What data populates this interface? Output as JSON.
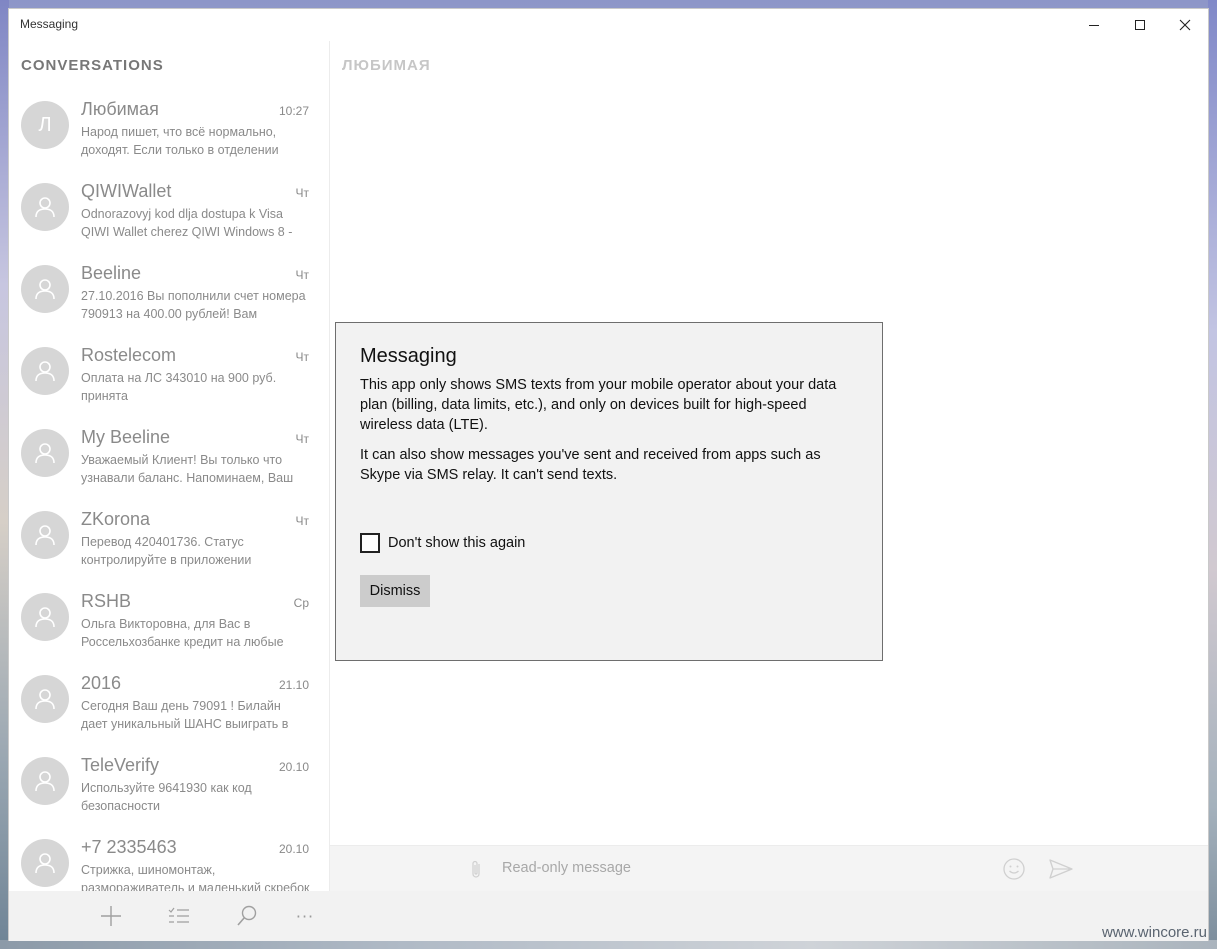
{
  "window": {
    "title": "Messaging"
  },
  "sidebar": {
    "header": "CONVERSATIONS",
    "conversations": [
      {
        "avatar_letter": "Л",
        "name": "Любимая",
        "time": "10:27",
        "preview": "Народ пишет, что всё нормально,\nдоходят. Если только в отделении"
      },
      {
        "avatar_letter": "",
        "name": "QIWIWallet",
        "time": "Чт",
        "preview": "Odnorazovyj kod dlja dostupa k Visa\nQIWI Wallet cherez QIWI Windows 8 -"
      },
      {
        "avatar_letter": "",
        "name": "Beeline",
        "time": "Чт",
        "preview": "27.10.2016 Вы пополнили счет номера\n790913           на 400.00 рублей! Вам"
      },
      {
        "avatar_letter": "",
        "name": "Rostelecom",
        "time": "Чт",
        "preview": "Оплата на ЛС 343010            на 900 руб.\nпринята"
      },
      {
        "avatar_letter": "",
        "name": "My Beeline",
        "time": "Чт",
        "preview": "Уважаемый Клиент! Вы только что\nузнавали баланс. Напоминаем, Ваш"
      },
      {
        "avatar_letter": "",
        "name": "ZKorona",
        "time": "Чт",
        "preview": "Перевод 420401736. Статус\nконтролируйте в приложении"
      },
      {
        "avatar_letter": "",
        "name": "RSHB",
        "time": "Ср",
        "preview": "Ольга Викторовна, для Вас в\nРоссельхозбанке кредит на любые"
      },
      {
        "avatar_letter": "",
        "name": "2016",
        "time": "21.10",
        "preview": "Сегодня Ваш день 79091           ! Билайн\nдает уникальный ШАНС выиграть в"
      },
      {
        "avatar_letter": "",
        "name": "TeleVerify",
        "time": "20.10",
        "preview": "Используйте 9641930 как код\nбезопасности"
      },
      {
        "avatar_letter": "",
        "name": "+7 2335463",
        "time": "20.10",
        "preview": "Стрижка, шиномонтаж,\nразмораживатель и маленький скребок"
      }
    ]
  },
  "main": {
    "conversation_title": "ЛЮБИМАЯ",
    "compose_placeholder": "Read-only message"
  },
  "dialog": {
    "title": "Messaging",
    "paragraph1": "This app only shows SMS texts from your mobile operator about your data plan (billing, data limits, etc.), and only on devices built for high-speed wireless data (LTE).",
    "paragraph2": "It can also show messages you've sent and received from apps such as Skype via SMS relay. It can't send texts.",
    "checkbox_label": "Don't show this again",
    "checkbox_checked": false,
    "dismiss_label": "Dismiss"
  },
  "app_bar": {
    "more_label": "···"
  },
  "watermark": "www.wincore.ru"
}
